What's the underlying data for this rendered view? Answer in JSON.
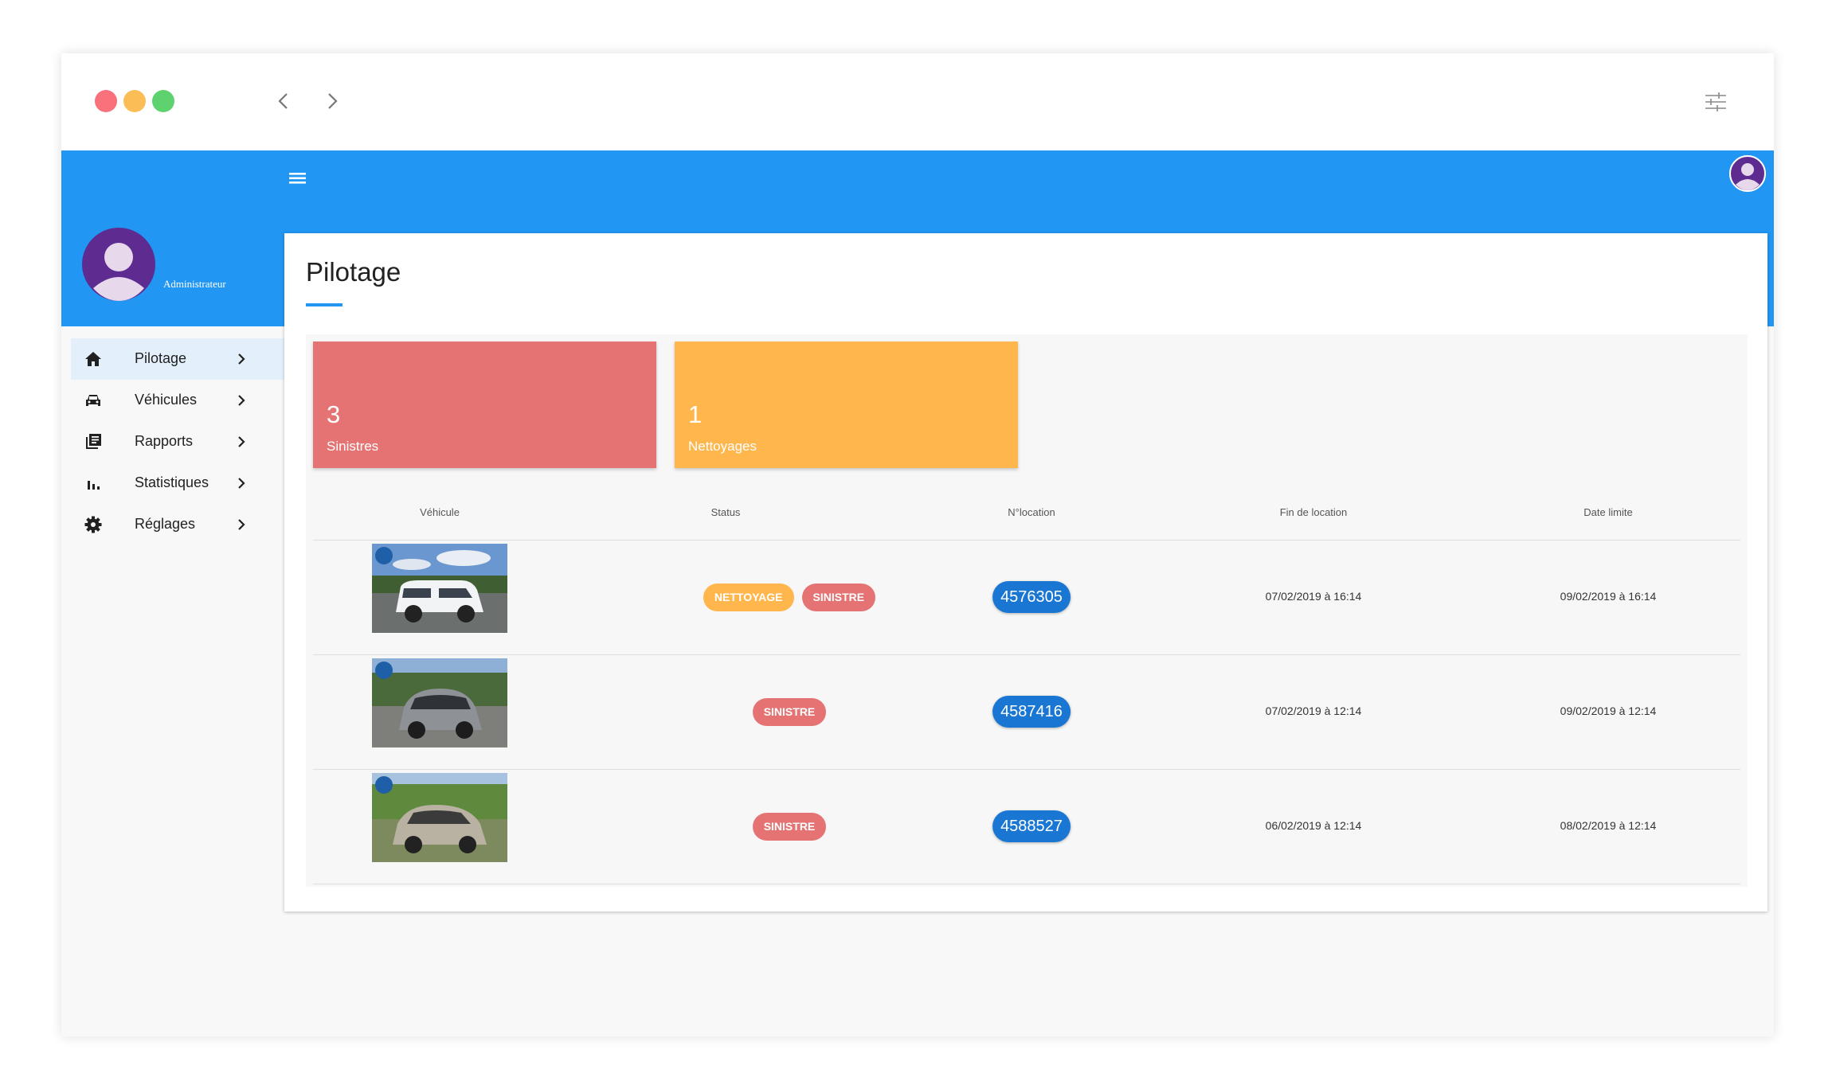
{
  "window": {
    "controls": [
      "close",
      "minimize",
      "maximize"
    ],
    "colors": {
      "close": "#f8717b",
      "minimize": "#fbbd55",
      "maximize": "#5ed26e",
      "header": "#2196f3"
    }
  },
  "user": {
    "role": "Administrateur"
  },
  "sidebar": {
    "items": [
      {
        "label": "Pilotage",
        "icon": "home-icon",
        "active": true
      },
      {
        "label": "Véhicules",
        "icon": "car-icon",
        "active": false
      },
      {
        "label": "Rapports",
        "icon": "library-icon",
        "active": false
      },
      {
        "label": "Statistiques",
        "icon": "bar-chart-icon",
        "active": false
      },
      {
        "label": "Réglages",
        "icon": "gear-icon",
        "active": false
      }
    ]
  },
  "page": {
    "title": "Pilotage"
  },
  "stats": [
    {
      "value": "3",
      "label": "Sinistres",
      "color": "#e57373"
    },
    {
      "value": "1",
      "label": "Nettoyages",
      "color": "#ffb74d"
    }
  ],
  "table": {
    "headers": [
      "Véhicule",
      "Status",
      "N°location",
      "Fin de location",
      "Date limite"
    ],
    "rows": [
      {
        "vehicle": "white-van-photo",
        "statuses": [
          "NETTOYAGE",
          "SINISTRE"
        ],
        "location": "4576305",
        "end": "07/02/2019 à 16:14",
        "deadline": "09/02/2019 à 16:14"
      },
      {
        "vehicle": "grey-smart-car-photo",
        "statuses": [
          "SINISTRE"
        ],
        "location": "4587416",
        "end": "07/02/2019 à 12:14",
        "deadline": "09/02/2019 à 12:14"
      },
      {
        "vehicle": "silver-hatchback-photo",
        "statuses": [
          "SINISTRE"
        ],
        "location": "4588527",
        "end": "06/02/2019 à 12:14",
        "deadline": "08/02/2019 à 12:14"
      }
    ]
  },
  "badge_colors": {
    "NETTOYAGE": "#ffb74d",
    "SINISTRE": "#e57373"
  }
}
